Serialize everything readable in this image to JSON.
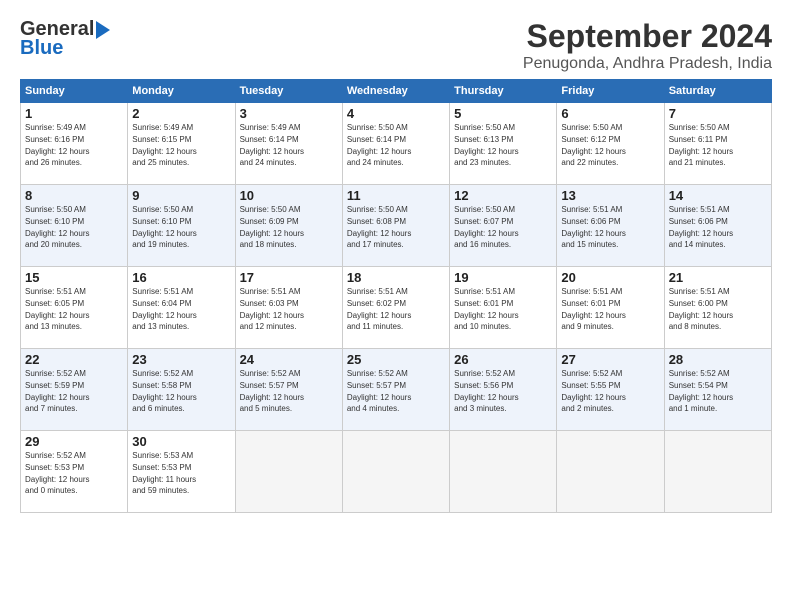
{
  "logo": {
    "line1": "General",
    "line2": "Blue"
  },
  "title": "September 2024",
  "location": "Penugonda, Andhra Pradesh, India",
  "headers": [
    "Sunday",
    "Monday",
    "Tuesday",
    "Wednesday",
    "Thursday",
    "Friday",
    "Saturday"
  ],
  "weeks": [
    [
      {
        "num": "1",
        "detail": "Sunrise: 5:49 AM\nSunset: 6:16 PM\nDaylight: 12 hours\nand 26 minutes."
      },
      {
        "num": "2",
        "detail": "Sunrise: 5:49 AM\nSunset: 6:15 PM\nDaylight: 12 hours\nand 25 minutes."
      },
      {
        "num": "3",
        "detail": "Sunrise: 5:49 AM\nSunset: 6:14 PM\nDaylight: 12 hours\nand 24 minutes."
      },
      {
        "num": "4",
        "detail": "Sunrise: 5:50 AM\nSunset: 6:14 PM\nDaylight: 12 hours\nand 24 minutes."
      },
      {
        "num": "5",
        "detail": "Sunrise: 5:50 AM\nSunset: 6:13 PM\nDaylight: 12 hours\nand 23 minutes."
      },
      {
        "num": "6",
        "detail": "Sunrise: 5:50 AM\nSunset: 6:12 PM\nDaylight: 12 hours\nand 22 minutes."
      },
      {
        "num": "7",
        "detail": "Sunrise: 5:50 AM\nSunset: 6:11 PM\nDaylight: 12 hours\nand 21 minutes."
      }
    ],
    [
      {
        "num": "8",
        "detail": "Sunrise: 5:50 AM\nSunset: 6:10 PM\nDaylight: 12 hours\nand 20 minutes."
      },
      {
        "num": "9",
        "detail": "Sunrise: 5:50 AM\nSunset: 6:10 PM\nDaylight: 12 hours\nand 19 minutes."
      },
      {
        "num": "10",
        "detail": "Sunrise: 5:50 AM\nSunset: 6:09 PM\nDaylight: 12 hours\nand 18 minutes."
      },
      {
        "num": "11",
        "detail": "Sunrise: 5:50 AM\nSunset: 6:08 PM\nDaylight: 12 hours\nand 17 minutes."
      },
      {
        "num": "12",
        "detail": "Sunrise: 5:50 AM\nSunset: 6:07 PM\nDaylight: 12 hours\nand 16 minutes."
      },
      {
        "num": "13",
        "detail": "Sunrise: 5:51 AM\nSunset: 6:06 PM\nDaylight: 12 hours\nand 15 minutes."
      },
      {
        "num": "14",
        "detail": "Sunrise: 5:51 AM\nSunset: 6:06 PM\nDaylight: 12 hours\nand 14 minutes."
      }
    ],
    [
      {
        "num": "15",
        "detail": "Sunrise: 5:51 AM\nSunset: 6:05 PM\nDaylight: 12 hours\nand 13 minutes."
      },
      {
        "num": "16",
        "detail": "Sunrise: 5:51 AM\nSunset: 6:04 PM\nDaylight: 12 hours\nand 13 minutes."
      },
      {
        "num": "17",
        "detail": "Sunrise: 5:51 AM\nSunset: 6:03 PM\nDaylight: 12 hours\nand 12 minutes."
      },
      {
        "num": "18",
        "detail": "Sunrise: 5:51 AM\nSunset: 6:02 PM\nDaylight: 12 hours\nand 11 minutes."
      },
      {
        "num": "19",
        "detail": "Sunrise: 5:51 AM\nSunset: 6:01 PM\nDaylight: 12 hours\nand 10 minutes."
      },
      {
        "num": "20",
        "detail": "Sunrise: 5:51 AM\nSunset: 6:01 PM\nDaylight: 12 hours\nand 9 minutes."
      },
      {
        "num": "21",
        "detail": "Sunrise: 5:51 AM\nSunset: 6:00 PM\nDaylight: 12 hours\nand 8 minutes."
      }
    ],
    [
      {
        "num": "22",
        "detail": "Sunrise: 5:52 AM\nSunset: 5:59 PM\nDaylight: 12 hours\nand 7 minutes."
      },
      {
        "num": "23",
        "detail": "Sunrise: 5:52 AM\nSunset: 5:58 PM\nDaylight: 12 hours\nand 6 minutes."
      },
      {
        "num": "24",
        "detail": "Sunrise: 5:52 AM\nSunset: 5:57 PM\nDaylight: 12 hours\nand 5 minutes."
      },
      {
        "num": "25",
        "detail": "Sunrise: 5:52 AM\nSunset: 5:57 PM\nDaylight: 12 hours\nand 4 minutes."
      },
      {
        "num": "26",
        "detail": "Sunrise: 5:52 AM\nSunset: 5:56 PM\nDaylight: 12 hours\nand 3 minutes."
      },
      {
        "num": "27",
        "detail": "Sunrise: 5:52 AM\nSunset: 5:55 PM\nDaylight: 12 hours\nand 2 minutes."
      },
      {
        "num": "28",
        "detail": "Sunrise: 5:52 AM\nSunset: 5:54 PM\nDaylight: 12 hours\nand 1 minute."
      }
    ],
    [
      {
        "num": "29",
        "detail": "Sunrise: 5:52 AM\nSunset: 5:53 PM\nDaylight: 12 hours\nand 0 minutes."
      },
      {
        "num": "30",
        "detail": "Sunrise: 5:53 AM\nSunset: 5:53 PM\nDaylight: 11 hours\nand 59 minutes."
      },
      {
        "num": "",
        "detail": ""
      },
      {
        "num": "",
        "detail": ""
      },
      {
        "num": "",
        "detail": ""
      },
      {
        "num": "",
        "detail": ""
      },
      {
        "num": "",
        "detail": ""
      }
    ]
  ],
  "alt_rows": [
    1,
    3
  ]
}
